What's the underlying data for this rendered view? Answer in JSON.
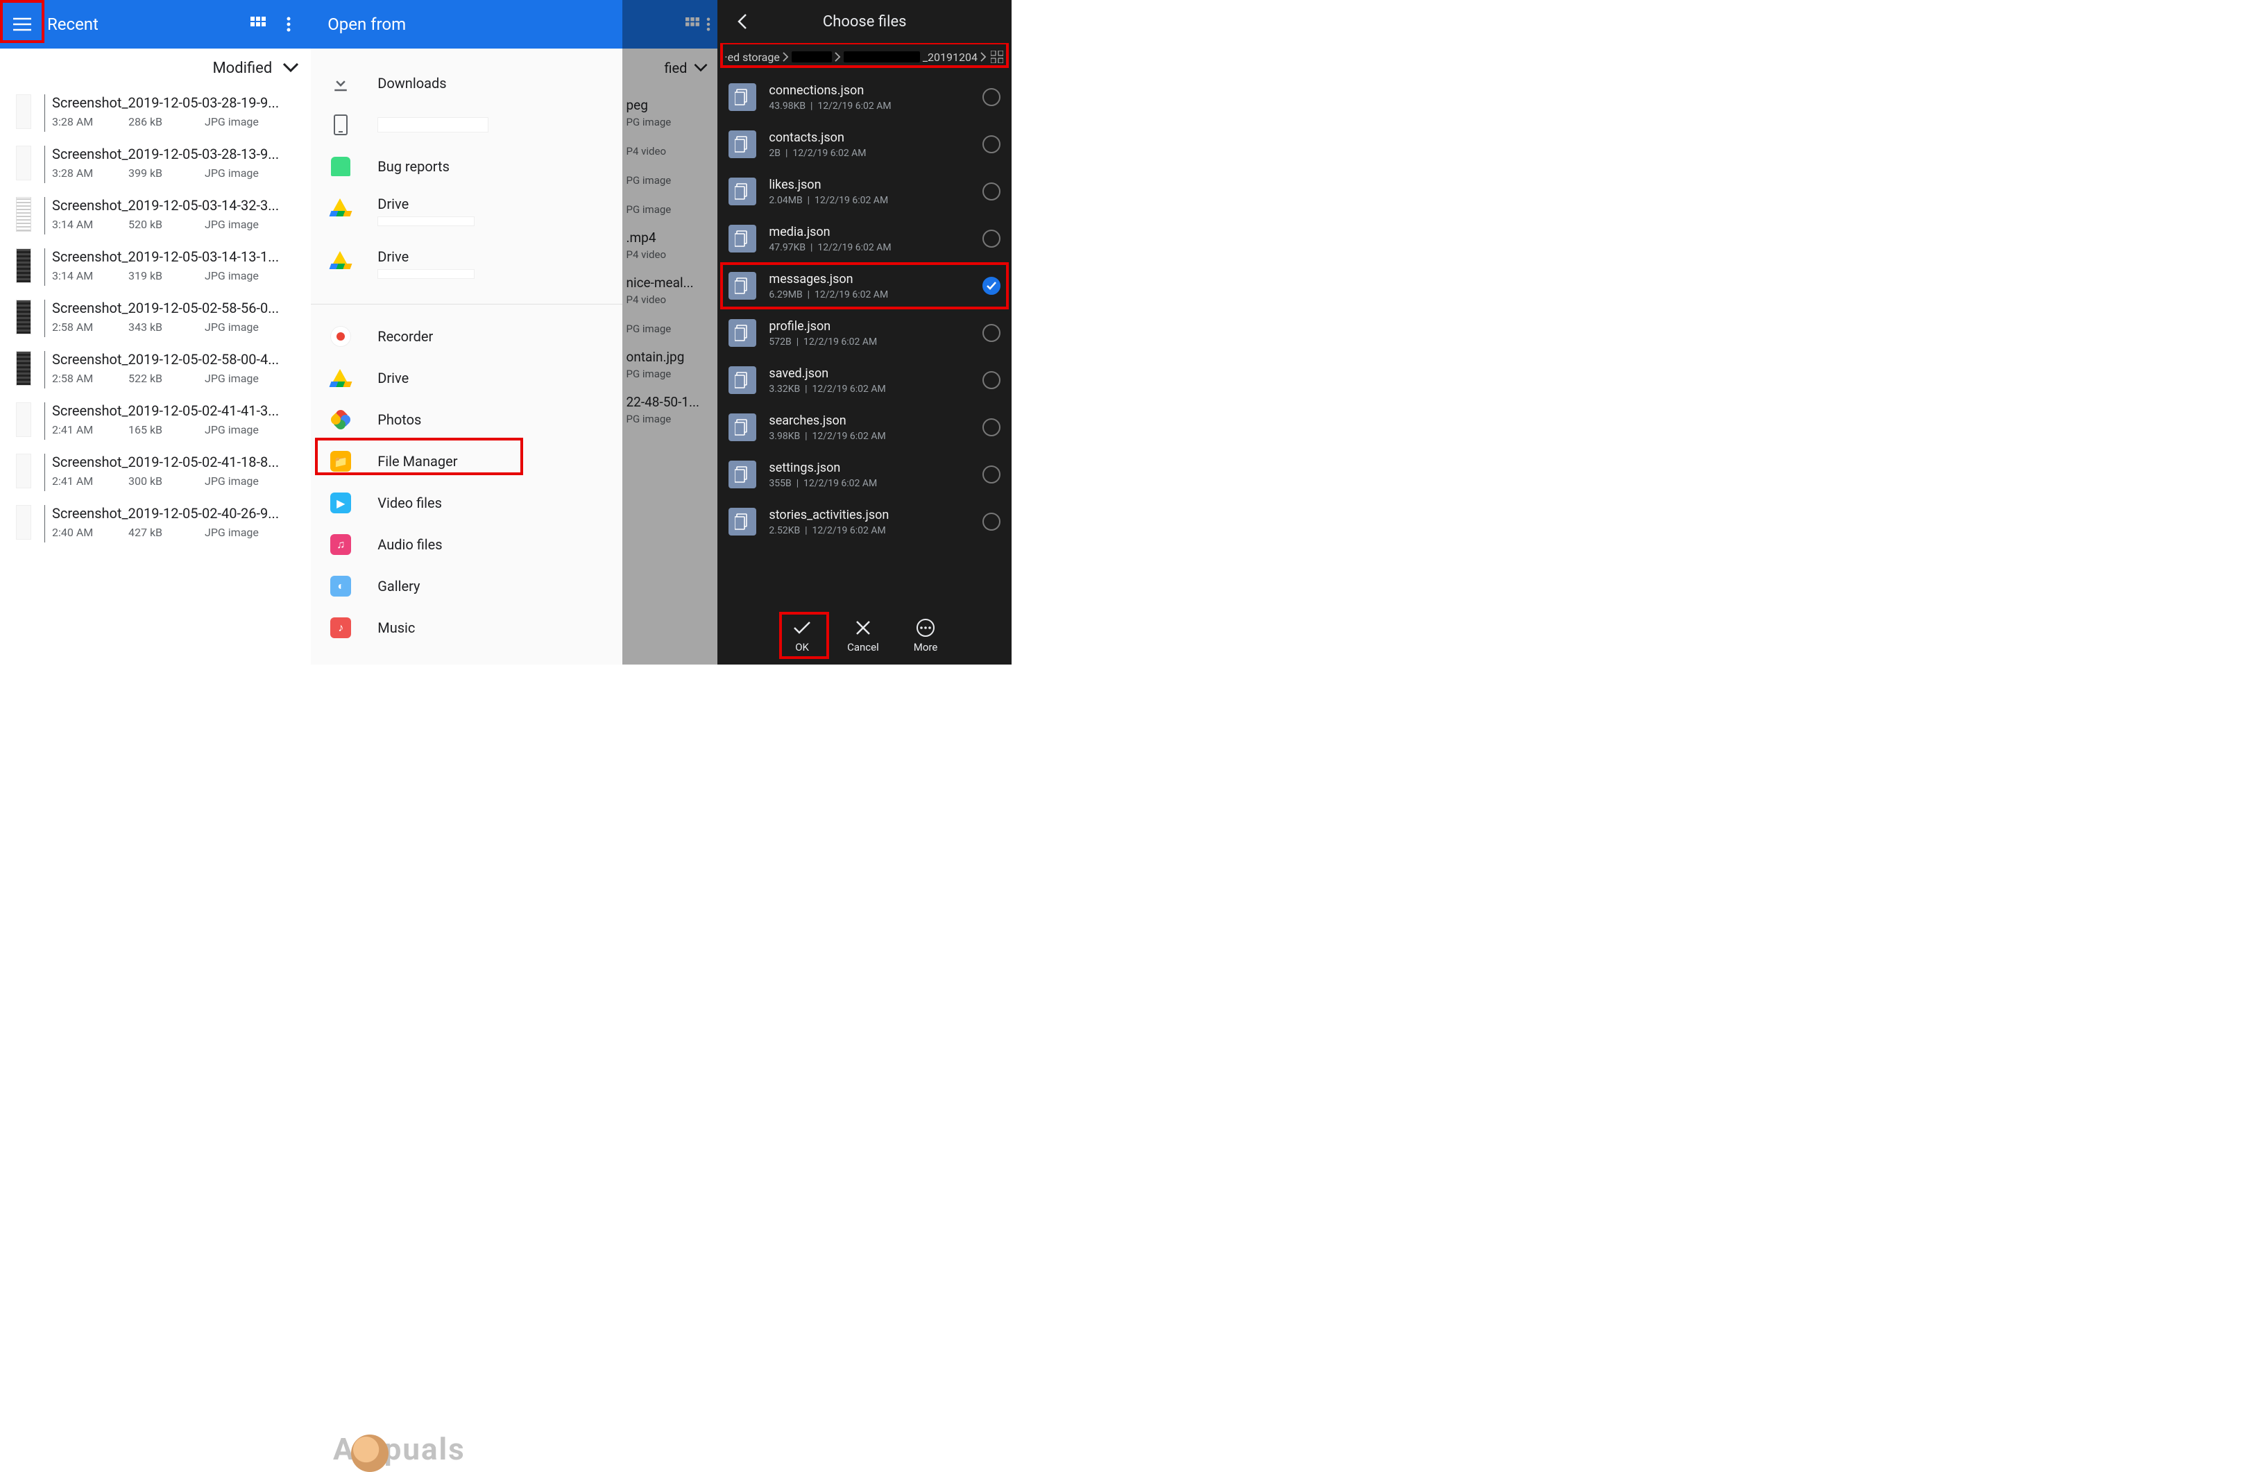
{
  "panel1": {
    "title": "Recent",
    "sort_label": "Modified",
    "files": [
      {
        "name": "Screenshot_2019-12-05-03-28-19-9...",
        "time": "3:28 AM",
        "size": "286 kB",
        "type": "JPG image",
        "thumb": "light"
      },
      {
        "name": "Screenshot_2019-12-05-03-28-13-9...",
        "time": "3:28 AM",
        "size": "399 kB",
        "type": "JPG image",
        "thumb": "light"
      },
      {
        "name": "Screenshot_2019-12-05-03-14-32-3...",
        "time": "3:14 AM",
        "size": "520 kB",
        "type": "JPG image",
        "thumb": "normal"
      },
      {
        "name": "Screenshot_2019-12-05-03-14-13-1...",
        "time": "3:14 AM",
        "size": "319 kB",
        "type": "JPG image",
        "thumb": "dark"
      },
      {
        "name": "Screenshot_2019-12-05-02-58-56-0...",
        "time": "2:58 AM",
        "size": "343 kB",
        "type": "JPG image",
        "thumb": "dark"
      },
      {
        "name": "Screenshot_2019-12-05-02-58-00-4...",
        "time": "2:58 AM",
        "size": "522 kB",
        "type": "JPG image",
        "thumb": "dark"
      },
      {
        "name": "Screenshot_2019-12-05-02-41-41-3...",
        "time": "2:41 AM",
        "size": "165 kB",
        "type": "JPG image",
        "thumb": "light"
      },
      {
        "name": "Screenshot_2019-12-05-02-41-18-8...",
        "time": "2:41 AM",
        "size": "300 kB",
        "type": "JPG image",
        "thumb": "light"
      },
      {
        "name": "Screenshot_2019-12-05-02-40-26-9...",
        "time": "2:40 AM",
        "size": "427 kB",
        "type": "JPG image",
        "thumb": "light"
      }
    ]
  },
  "panel2": {
    "title": "Open from",
    "items_top": [
      {
        "icon": "download",
        "label": "Downloads"
      },
      {
        "icon": "phone",
        "label": "",
        "redacted": true
      },
      {
        "icon": "android",
        "label": "Bug reports"
      },
      {
        "icon": "gdrive",
        "label": "Drive",
        "sub": true
      },
      {
        "icon": "gdrive",
        "label": "Drive",
        "sub": true
      }
    ],
    "items_bottom": [
      {
        "icon": "recorder",
        "color": "#fff",
        "label": "Recorder"
      },
      {
        "icon": "gdrive",
        "label": "Drive"
      },
      {
        "icon": "photos",
        "label": "Photos"
      },
      {
        "icon": "filemanager",
        "color": "#ffb300",
        "label": "File Manager"
      },
      {
        "icon": "video",
        "color": "#29b6f6",
        "label": "Video files"
      },
      {
        "icon": "audio",
        "color": "#ec407a",
        "label": "Audio files"
      },
      {
        "icon": "gallery",
        "color": "#5c6bc0",
        "label": "Gallery"
      },
      {
        "icon": "music",
        "color": "#ef5350",
        "label": "Music"
      }
    ]
  },
  "panel3": {
    "sort_label_tail": "fied",
    "items": [
      {
        "name": "peg",
        "meta": "PG image"
      },
      {
        "name": "",
        "meta": "P4 video"
      },
      {
        "name": "",
        "meta": "PG image"
      },
      {
        "name": "",
        "meta": "PG image"
      },
      {
        "name": ".mp4",
        "meta": "P4 video"
      },
      {
        "name": "nice-meal...",
        "meta": "P4 video"
      },
      {
        "name": "",
        "meta": "PG image"
      },
      {
        "name": "ontain.jpg",
        "meta": "PG image"
      },
      {
        "name": "22-48-50-1...",
        "meta": "PG image"
      }
    ]
  },
  "panel4": {
    "title": "Choose files",
    "breadcrumb": {
      "seg1": "·ed storage",
      "seg_tail": "_20191204"
    },
    "files": [
      {
        "name": "connections.json",
        "size": "43.98KB",
        "date": "12/2/19 6:02 AM",
        "sel": false
      },
      {
        "name": "contacts.json",
        "size": "2B",
        "date": "12/2/19 6:02 AM",
        "sel": false
      },
      {
        "name": "likes.json",
        "size": "2.04MB",
        "date": "12/2/19 6:02 AM",
        "sel": false
      },
      {
        "name": "media.json",
        "size": "47.97KB",
        "date": "12/2/19 6:02 AM",
        "sel": false
      },
      {
        "name": "messages.json",
        "size": "6.29MB",
        "date": "12/2/19 6:02 AM",
        "sel": true
      },
      {
        "name": "profile.json",
        "size": "572B",
        "date": "12/2/19 6:02 AM",
        "sel": false
      },
      {
        "name": "saved.json",
        "size": "3.32KB",
        "date": "12/2/19 6:02 AM",
        "sel": false
      },
      {
        "name": "searches.json",
        "size": "3.98KB",
        "date": "12/2/19 6:02 AM",
        "sel": false
      },
      {
        "name": "settings.json",
        "size": "355B",
        "date": "12/2/19 6:02 AM",
        "sel": false
      },
      {
        "name": "stories_activities.json",
        "size": "2.52KB",
        "date": "12/2/19 6:02 AM",
        "sel": false
      }
    ],
    "buttons": {
      "ok": "OK",
      "cancel": "Cancel",
      "more": "More"
    }
  },
  "watermark": {
    "pre": "A",
    "post": "puals"
  }
}
